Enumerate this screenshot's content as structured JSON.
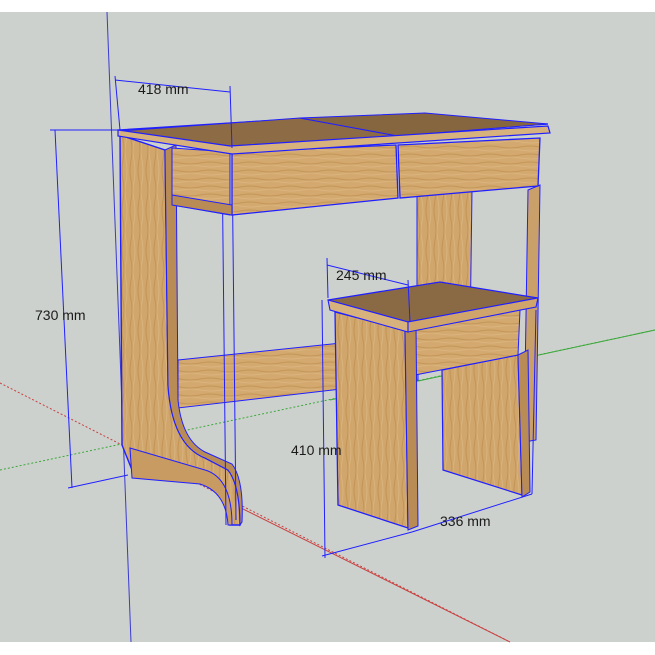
{
  "scene": {
    "description_hidden": "",
    "colors": {
      "background": "#cfd3cf",
      "wood_light": "#d6ad74",
      "wood_mid": "#c99b62",
      "wood_dark": "#8a6a45",
      "edge": "#1c1cff",
      "axis_red": "#d04040",
      "axis_green": "#3aa83a",
      "axis_blue": "#3030e0"
    }
  },
  "dimensions": {
    "desk_depth": "418 mm",
    "desk_height": "730 mm",
    "stool_depth": "245 mm",
    "stool_height": "410 mm",
    "stool_width": "336 mm"
  }
}
